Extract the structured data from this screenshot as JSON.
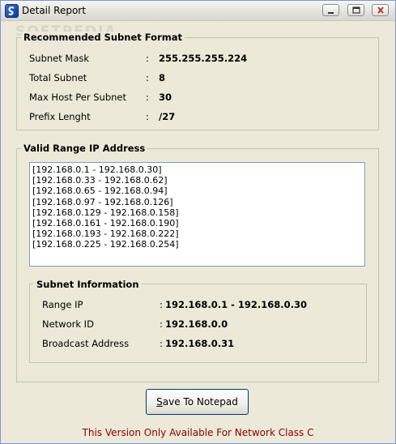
{
  "window": {
    "title": "Detail Report",
    "watermark": "SOFTPEDIA"
  },
  "recommended": {
    "legend": "Recommended Subnet Format",
    "rows": [
      {
        "label": "Subnet Mask",
        "value": "255.255.255.224"
      },
      {
        "label": "Total Subnet",
        "value": "8"
      },
      {
        "label": "Max Host Per Subnet",
        "value": "30"
      },
      {
        "label": "Prefix Lenght",
        "value": "/27"
      }
    ]
  },
  "valid_range": {
    "legend": "Valid Range IP Address",
    "items": [
      "[192.168.0.1 - 192.168.0.30]",
      "[192.168.0.33 - 192.168.0.62]",
      "[192.168.0.65 - 192.168.0.94]",
      "[192.168.0.97 - 192.168.0.126]",
      "[192.168.0.129 - 192.168.0.158]",
      "[192.168.0.161 - 192.168.0.190]",
      "[192.168.0.193 - 192.168.0.222]",
      "[192.168.0.225 - 192.168.0.254]"
    ]
  },
  "subnet_info": {
    "legend": "Subnet Information",
    "rows": [
      {
        "label": "Range IP",
        "value": "192.168.0.1 - 192.168.0.30"
      },
      {
        "label": "Network ID",
        "value": "192.168.0.0"
      },
      {
        "label": "Broadcast Address",
        "value": "192.168.0.31"
      }
    ]
  },
  "actions": {
    "save_label_underlined": "S",
    "save_label_rest": "ave To Notepad"
  },
  "footer": "This Version Only Available For Network Class C"
}
